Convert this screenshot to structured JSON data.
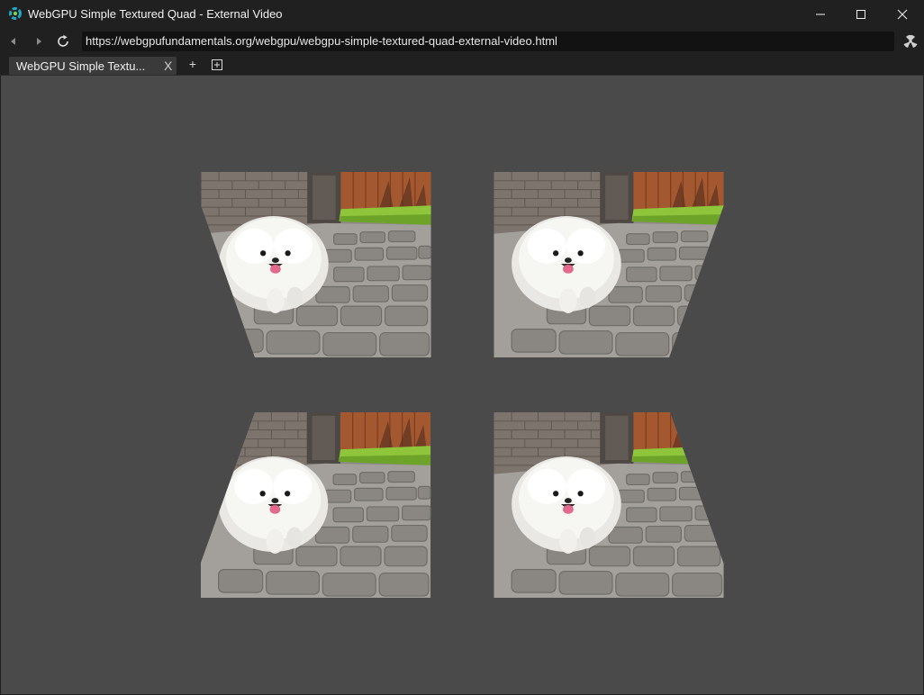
{
  "window": {
    "title": "WebGPU Simple Textured Quad - External Video"
  },
  "navigation": {
    "url": "https://webgpufundamentals.org/webgpu/webgpu-simple-textured-quad-external-video.html",
    "icons": [
      "back-arrow-icon",
      "forward-arrow-icon",
      "reload-icon",
      "extension-icon"
    ]
  },
  "tabs": [
    {
      "label": "WebGPU Simple Textu...",
      "close_label": "X",
      "active": true
    }
  ],
  "tabstrip": {
    "new_tab_label": "+"
  },
  "page": {
    "background": "#4a4a4a",
    "quad_count": 4
  },
  "colors": {
    "titlebar": "#202020",
    "urlbar": "#121212",
    "tab_active": "#3a3a3a",
    "page_bg": "#4a4a4a",
    "brick": "#8a7f78",
    "fence": "#a0552f",
    "grass": "#8fc43a",
    "paving": "#9a968f",
    "dog": "#f4f4f2"
  }
}
